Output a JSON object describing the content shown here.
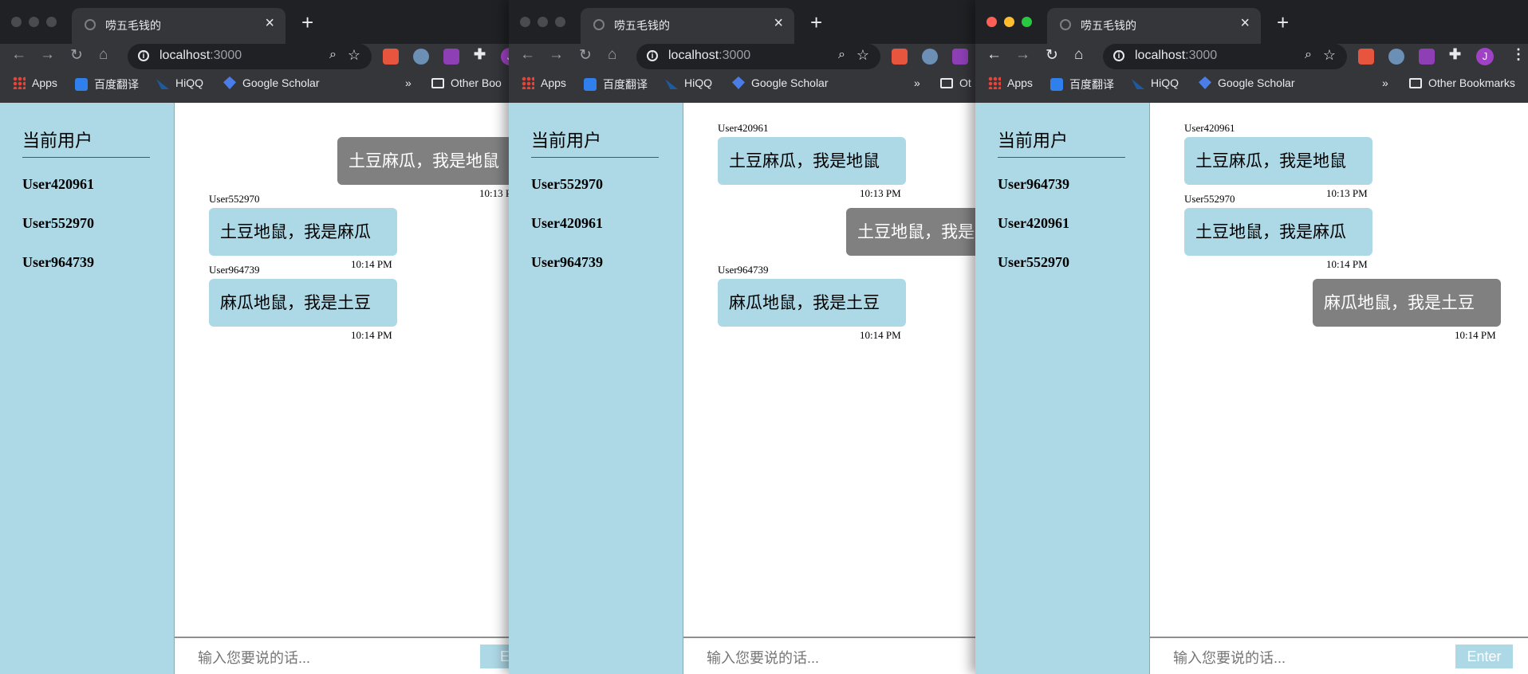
{
  "browser": {
    "tab_title": "唠五毛钱的",
    "url_host": "localhost",
    "url_port": ":3000",
    "bookmarks": {
      "apps": "Apps",
      "baidu": "百度翻译",
      "hiqq": "HiQQ",
      "scholar": "Google Scholar",
      "overflow": "»",
      "other": "Other Bookmarks",
      "other_w1": "Other Boo",
      "other_w2": "Ot"
    },
    "avatar_letter": "J"
  },
  "app": {
    "sidebar_title": "当前用户",
    "input_placeholder": "输入您要说的话...",
    "enter_label": "Enter",
    "enter_w1": "En"
  },
  "windows": [
    {
      "users": [
        "User420961",
        "User552970",
        "User964739"
      ],
      "messages": [
        {
          "text": "土豆麻瓜，我是地鼠",
          "time": "10:13 P",
          "mine": true
        },
        {
          "name": "User552970",
          "text": "土豆地鼠，我是麻瓜",
          "time": "10:14 PM"
        },
        {
          "name": "User964739",
          "text": "麻瓜地鼠，我是土豆",
          "time": "10:14 PM"
        }
      ]
    },
    {
      "users": [
        "User552970",
        "User420961",
        "User964739"
      ],
      "messages": [
        {
          "name": "User420961",
          "text": "土豆麻瓜，我是地鼠",
          "time": "10:13 PM"
        },
        {
          "text": "土豆地鼠，我是",
          "mine": true
        },
        {
          "name": "User964739",
          "text": "麻瓜地鼠，我是土豆",
          "time": "10:14 PM"
        }
      ]
    },
    {
      "users": [
        "User964739",
        "User420961",
        "User552970"
      ],
      "messages": [
        {
          "name": "User420961",
          "text": "土豆麻瓜，我是地鼠",
          "time": "10:13 PM"
        },
        {
          "name": "User552970",
          "text": "土豆地鼠，我是麻瓜",
          "time": "10:14 PM"
        },
        {
          "text": "麻瓜地鼠，我是土豆",
          "time": "10:14 PM",
          "mine": true
        }
      ]
    }
  ]
}
